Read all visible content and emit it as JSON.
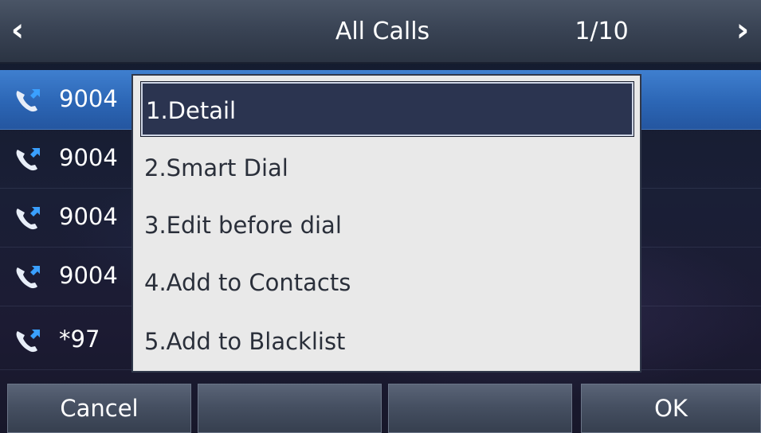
{
  "header": {
    "title": "All Calls",
    "page_indicator": "1/10",
    "prev_icon": "‹",
    "next_icon": "›"
  },
  "call_list": [
    {
      "number": "9004",
      "icon": "phone-incoming-icon"
    },
    {
      "number": "9004",
      "icon": "phone-incoming-icon"
    },
    {
      "number": "9004",
      "icon": "phone-incoming-icon"
    },
    {
      "number": "9004",
      "icon": "phone-incoming-icon"
    },
    {
      "number": "*97",
      "icon": "phone-incoming-icon"
    }
  ],
  "menu": {
    "items": [
      {
        "label": "1.Detail",
        "selected": true
      },
      {
        "label": "2.Smart Dial"
      },
      {
        "label": "3.Edit before dial"
      },
      {
        "label": "4.Add to Contacts"
      },
      {
        "label": "5.Add to Blacklist"
      }
    ]
  },
  "softkeys": [
    "Cancel",
    "",
    "",
    "OK"
  ],
  "colors": {
    "selected_row": "#2c66b5",
    "menu_highlight": "#2b3450",
    "menu_background": "#e9e9e9"
  }
}
